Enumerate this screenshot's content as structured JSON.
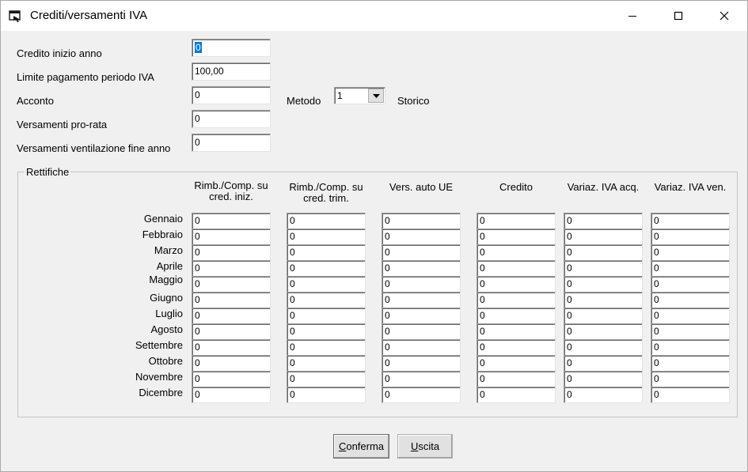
{
  "window": {
    "title": "Crediti/versamenti IVA"
  },
  "form": {
    "credito_inizio_anno": {
      "label": "Credito inizio anno",
      "value": "0"
    },
    "limite_pagamento": {
      "label": "Limite pagamento periodo IVA",
      "value": "100,00"
    },
    "acconto": {
      "label": "Acconto",
      "value": "0"
    },
    "versamenti_pro_rata": {
      "label": "Versamenti pro-rata",
      "value": "0"
    },
    "versamenti_ventilazione": {
      "label": "Versamenti ventilazione fine anno",
      "value": "0"
    },
    "metodo": {
      "label": "Metodo",
      "value": "1",
      "description": "Storico"
    }
  },
  "rettifiche": {
    "legend": "Rettifiche",
    "columns": [
      "Rimb./Comp. su cred. iniz.",
      "Rimb./Comp. su cred. trim.",
      "Vers. auto UE",
      "Credito",
      "Variaz. IVA acq.",
      "Variaz. IVA ven."
    ],
    "months": [
      "Gennaio",
      "Febbraio",
      "Marzo",
      "Aprile",
      "Maggio",
      "Giugno",
      "Luglio",
      "Agosto",
      "Settembre",
      "Ottobre",
      "Novembre",
      "Dicembre"
    ],
    "values": [
      [
        "0",
        "0",
        "0",
        "0",
        "0",
        "0"
      ],
      [
        "0",
        "0",
        "0",
        "0",
        "0",
        "0"
      ],
      [
        "0",
        "0",
        "0",
        "0",
        "0",
        "0"
      ],
      [
        "0",
        "0",
        "0",
        "0",
        "0",
        "0"
      ],
      [
        "0",
        "0",
        "0",
        "0",
        "0",
        "0"
      ],
      [
        "0",
        "0",
        "0",
        "0",
        "0",
        "0"
      ],
      [
        "0",
        "0",
        "0",
        "0",
        "0",
        "0"
      ],
      [
        "0",
        "0",
        "0",
        "0",
        "0",
        "0"
      ],
      [
        "0",
        "0",
        "0",
        "0",
        "0",
        "0"
      ],
      [
        "0",
        "0",
        "0",
        "0",
        "0",
        "0"
      ],
      [
        "0",
        "0",
        "0",
        "0",
        "0",
        "0"
      ],
      [
        "0",
        "0",
        "0",
        "0",
        "0",
        "0"
      ]
    ]
  },
  "buttons": {
    "conferma": {
      "accel": "C",
      "rest": "onferma"
    },
    "uscita": {
      "accel": "U",
      "rest": "scita"
    }
  }
}
